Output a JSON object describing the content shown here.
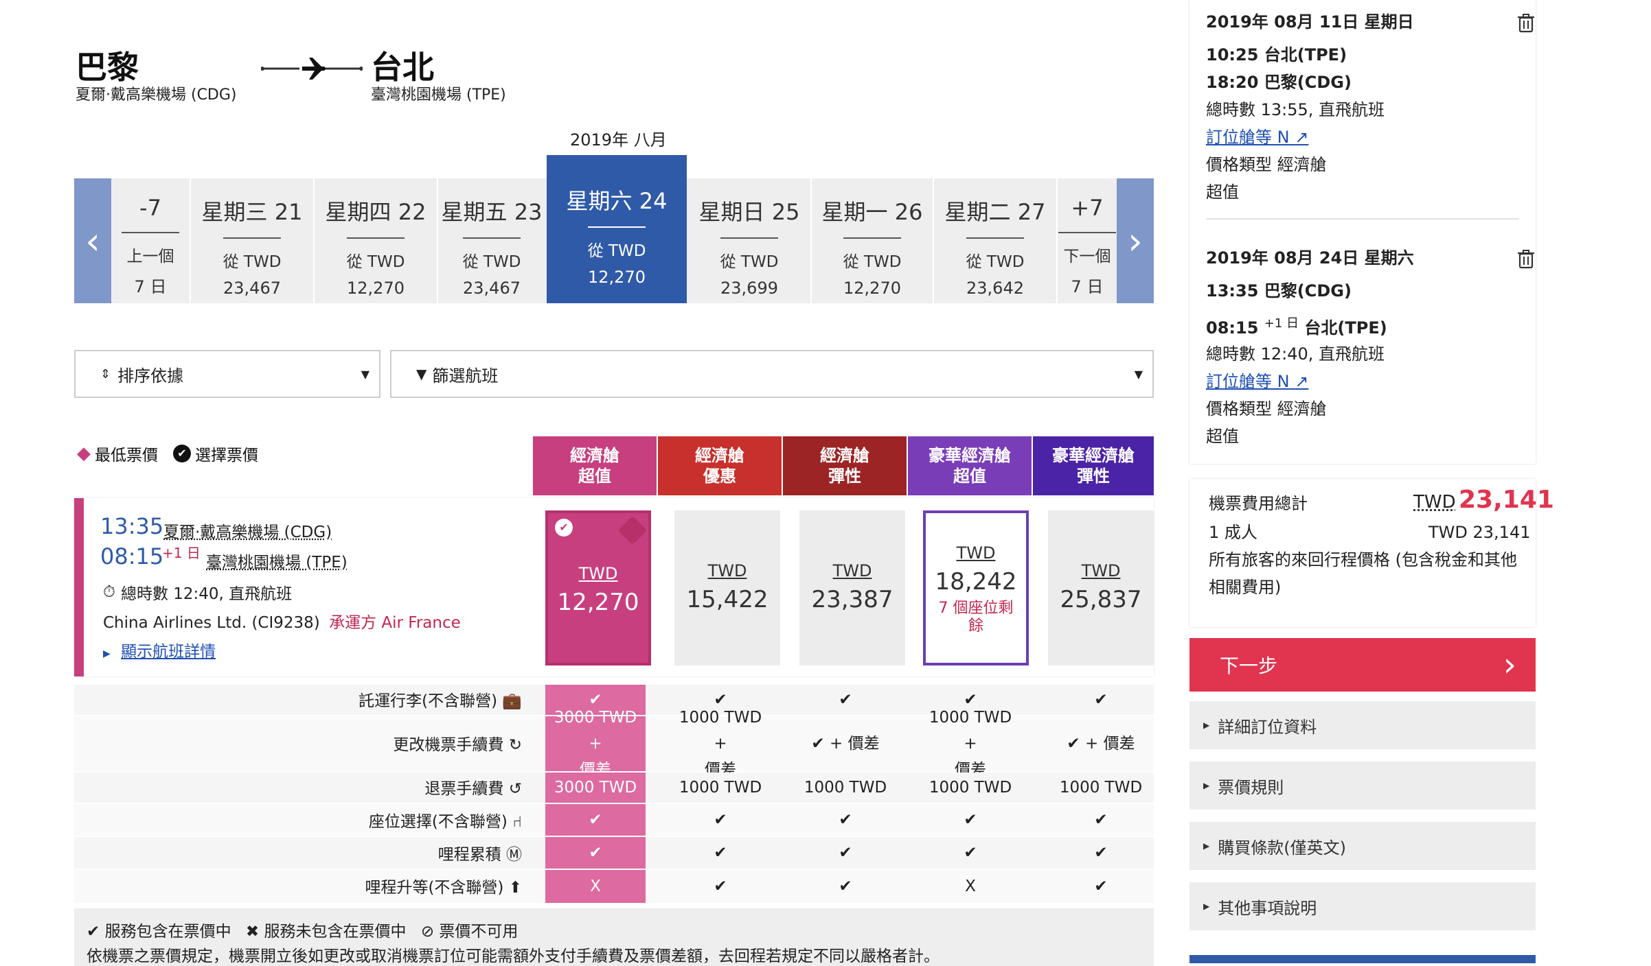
{
  "route": {
    "origin_city": "巴黎",
    "origin_airport": "夏爾·戴高樂機場 (CDG)",
    "dest_city": "台北",
    "dest_airport": "臺灣桃園機場 (TPE)"
  },
  "date_strip": {
    "month_label": "2019年 八月",
    "prev_label_top": "-7",
    "prev_label_l1": "上一個",
    "prev_label_l2": "7 日",
    "next_label_top": "+7",
    "next_label_l1": "下一個",
    "next_label_l2": "7 日",
    "from_label": "從 TWD",
    "days": [
      {
        "label": "星期三 21",
        "price": "23,467"
      },
      {
        "label": "星期四 22",
        "price": "12,270"
      },
      {
        "label": "星期五 23",
        "price": "23,467"
      },
      {
        "label": "星期六 24",
        "price": "12,270"
      },
      {
        "label": "星期日 25",
        "price": "23,699"
      },
      {
        "label": "星期一 26",
        "price": "12,270"
      },
      {
        "label": "星期二 27",
        "price": "23,642"
      }
    ]
  },
  "controls": {
    "sort_label": "排序依據",
    "filter_label": "篩選航班"
  },
  "legend": {
    "lowest": "最低票價",
    "selected": "選擇票價"
  },
  "fare_headers": [
    {
      "l1": "經濟艙",
      "l2": "超值",
      "color": "#c73f7f"
    },
    {
      "l1": "經濟艙",
      "l2": "優惠",
      "color": "#c7302c"
    },
    {
      "l1": "經濟艙",
      "l2": "彈性",
      "color": "#9c2425"
    },
    {
      "l1": "豪華經濟艙",
      "l2": "超值",
      "color": "#7a3db8"
    },
    {
      "l1": "豪華經濟艙",
      "l2": "彈性",
      "color": "#4b23a6"
    }
  ],
  "flight": {
    "dep_time": "13:35",
    "dep_airport": "夏爾·戴高樂機場 (CDG)",
    "arr_time": "08:15",
    "arr_plus": "+1 日",
    "arr_airport": "臺灣桃園機場 (TPE)",
    "duration": "總時數 12:40, 直飛航班",
    "carrier": "China Airlines Ltd. (CI9238)",
    "operated_by": "承運方 Air France",
    "details_link": "顯示航班詳情"
  },
  "fares": [
    {
      "currency": "TWD",
      "amount": "12,270",
      "note": ""
    },
    {
      "currency": "TWD",
      "amount": "15,422",
      "note": ""
    },
    {
      "currency": "TWD",
      "amount": "23,387",
      "note": ""
    },
    {
      "currency": "TWD",
      "amount": "18,242",
      "note_l1": "7 個座位剩",
      "note_l2": "餘"
    },
    {
      "currency": "TWD",
      "amount": "25,837",
      "note": ""
    }
  ],
  "features": [
    {
      "label": "託運行李(不含聯營)",
      "cells": [
        "✔",
        "✔",
        "✔",
        "✔",
        "✔"
      ]
    },
    {
      "label": "更改機票手續費",
      "cells_l1": [
        "3000 TWD +",
        "1000 TWD +",
        "✔ + 價差",
        "1000 TWD +",
        "✔ + 價差"
      ],
      "cells_l2": [
        "價差",
        "價差",
        "",
        "價差",
        ""
      ]
    },
    {
      "label": "退票手續費",
      "cells": [
        "3000 TWD",
        "1000 TWD",
        "1000 TWD",
        "1000 TWD",
        "1000 TWD"
      ]
    },
    {
      "label": "座位選擇(不含聯營)",
      "cells": [
        "✔",
        "✔",
        "✔",
        "✔",
        "✔"
      ]
    },
    {
      "label": "哩程累積",
      "cells": [
        "✔",
        "✔",
        "✔",
        "✔",
        "✔"
      ]
    },
    {
      "label": "哩程升等(不含聯營)",
      "cells": [
        "X",
        "✔",
        "✔",
        "X",
        "✔"
      ]
    }
  ],
  "footer": {
    "included": "服務包含在票價中",
    "not_included": "服務未包含在票價中",
    "unavailable": "票價不可用",
    "note": "依機票之票價規定，機票開立後如更改或取消機票訂位可能需額外支付手續費及票價差額，去回程若規定不同以嚴格者計。"
  },
  "itinerary": [
    {
      "date": "2019年 08月 11日 星期日",
      "dep": "10:25 台北(TPE)",
      "arr": "18:20 巴黎(CDG)",
      "arr_plus": "",
      "duration": "總時數 13:55, 直飛航班",
      "class_link": "訂位艙等 N",
      "fare_type": "價格類型 經濟艙",
      "fare_family": "超值"
    },
    {
      "date": "2019年 08月 24日 星期六",
      "dep": "13:35 巴黎(CDG)",
      "arr": "08:15",
      "arr_plus": "+1 日",
      "arr_city": "台北(TPE)",
      "duration": "總時數 12:40, 直飛航班",
      "class_link": "訂位艙等 N",
      "fare_type": "價格類型 經濟艙",
      "fare_family": "超值"
    }
  ],
  "summary": {
    "total_label": "機票費用總計",
    "total_currency": "TWD",
    "total_amount": "23,141",
    "adults_label": "1 成人",
    "adults_amount": "TWD 23,141",
    "note": "所有旅客的來回行程價格 (包含稅金和其他相關費用)"
  },
  "next_button": "下一步",
  "accordions": [
    "詳細訂位資料",
    "票價規則",
    "購買條款(僅英文)",
    "其他事項說明"
  ],
  "colors": {
    "primary_blue": "#2f5aa8",
    "pink": "#c73f7f",
    "next_red": "#e0344f",
    "link_blue": "#1f4fb3"
  }
}
